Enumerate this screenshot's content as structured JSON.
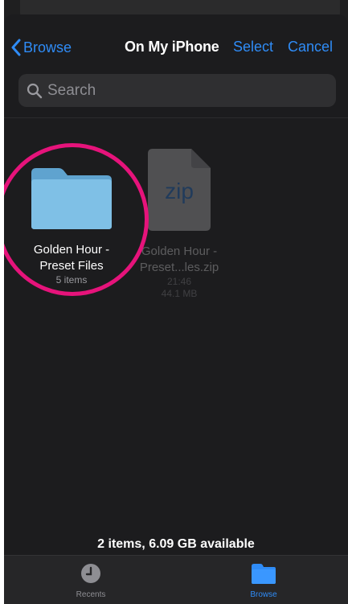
{
  "nav": {
    "back_label": "Browse",
    "title": "On My iPhone",
    "select_label": "Select",
    "cancel_label": "Cancel"
  },
  "search": {
    "placeholder": "Search"
  },
  "files": [
    {
      "name_line1": "Golden Hour -",
      "name_line2": "Preset Files",
      "meta_line1": "5 items",
      "type": "folder"
    },
    {
      "name_line1": "Golden Hour -",
      "name_line2": "Preset...les.zip",
      "meta_line1": "21:46",
      "meta_line2": "44.1 MB",
      "type": "zip",
      "icon_text": "zip"
    }
  ],
  "footer": {
    "summary": "2 items, 6.09 GB available"
  },
  "tabbar": {
    "recents_label": "Recents",
    "browse_label": "Browse"
  },
  "colors": {
    "accent": "#2f8cf7",
    "highlight": "#e6137b",
    "background": "#1c1c1e"
  }
}
